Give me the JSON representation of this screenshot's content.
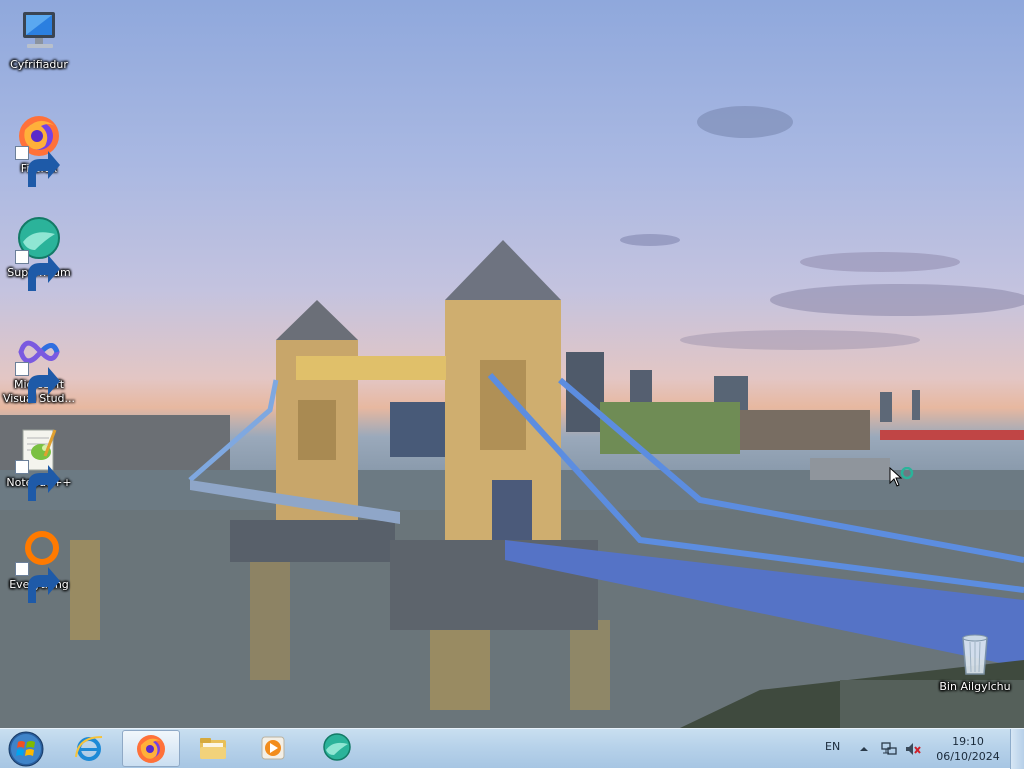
{
  "desktop": {
    "icons": [
      {
        "label": "Cyfrifiadur",
        "icon": "computer-icon",
        "shortcut": false
      },
      {
        "label": "Firefox",
        "icon": "firefox-icon",
        "shortcut": true
      },
      {
        "label": "Supermium",
        "icon": "supermium-icon",
        "shortcut": true
      },
      {
        "label": "Microsoft Visual Stud...",
        "icon": "visual-studio-icon",
        "shortcut": true
      },
      {
        "label": "Notepad++",
        "icon": "notepad-plus-plus-icon",
        "shortcut": true
      },
      {
        "label": "Everything",
        "icon": "everything-search-icon",
        "shortcut": true
      },
      {
        "label": "Bin Ailgylchu",
        "icon": "recycle-bin-icon",
        "shortcut": false
      }
    ],
    "wallpaper": "tower-bridge-london-dusk"
  },
  "taskbar": {
    "start": "windows-start-orb-icon",
    "pinned": [
      {
        "name": "internet-explorer-icon",
        "active": false
      },
      {
        "name": "firefox-icon",
        "active": true
      },
      {
        "name": "file-explorer-icon",
        "active": false
      },
      {
        "name": "media-player-icon",
        "active": false
      },
      {
        "name": "supermium-icon",
        "active": false
      }
    ],
    "tray": {
      "language": "EN",
      "time": "19:10",
      "date": "06/10/2024"
    }
  },
  "colors": {
    "taskbar": "#b7d2ea",
    "firefox_orange": "#ff7139",
    "supermium_teal": "#2bb39a"
  }
}
